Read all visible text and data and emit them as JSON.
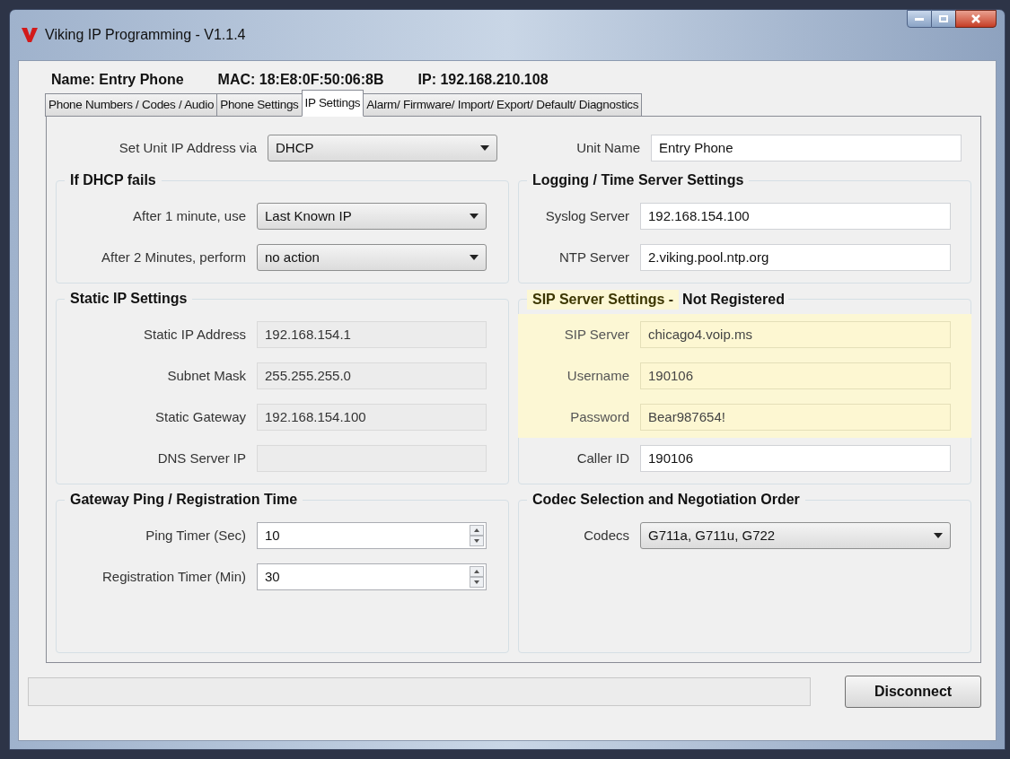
{
  "window": {
    "title": "Viking IP Programming - V1.1.4"
  },
  "header": [
    "Name: Entry Phone",
    "MAC: 18:E8:0F:50:06:8B",
    "IP: 192.168.210.108"
  ],
  "tabs": [
    {
      "label": "Phone Numbers / Codes / Audio",
      "selected": false
    },
    {
      "label": "Phone Settings",
      "selected": false
    },
    {
      "label": "IP Settings",
      "selected": true
    },
    {
      "label": "Alarm/ Firmware/ Import/ Export/ Default/ Diagnostics",
      "selected": false
    }
  ],
  "left": {
    "top": {
      "label": "Set Unit IP Address via",
      "value": "DHCP",
      "kind": "dropdown",
      "disabled": false,
      "highlighted": false
    },
    "groups": [
      {
        "title": "If DHCP fails",
        "highlighted": false,
        "fields": [
          {
            "label": "After 1 minute, use",
            "value": "Last Known IP",
            "kind": "dropdown",
            "disabled": false,
            "highlighted": false
          },
          {
            "label": "After 2 Minutes, perform",
            "value": "no action",
            "kind": "dropdown",
            "disabled": false,
            "highlighted": false
          }
        ]
      },
      {
        "title": "Static IP Settings",
        "highlighted": false,
        "fields": [
          {
            "label": "Static IP Address",
            "value": "192.168.154.1",
            "kind": "text",
            "disabled": true,
            "highlighted": false
          },
          {
            "label": "Subnet Mask",
            "value": "255.255.255.0",
            "kind": "text",
            "disabled": true,
            "highlighted": false
          },
          {
            "label": "Static Gateway",
            "value": "192.168.154.100",
            "kind": "text",
            "disabled": true,
            "highlighted": false
          },
          {
            "label": "DNS Server IP",
            "kind": "text",
            "disabled": true,
            "highlighted": false
          }
        ]
      },
      {
        "title": "Gateway Ping / Registration Time",
        "highlighted": false,
        "fields": [
          {
            "label": "Ping Timer (Sec)",
            "value": "10",
            "kind": "spinner",
            "disabled": false,
            "highlighted": false
          },
          {
            "label": "Registration Timer (Min)",
            "value": "30",
            "kind": "spinner",
            "disabled": false,
            "highlighted": false
          }
        ]
      }
    ]
  },
  "right": {
    "top": {
      "label": "Unit Name",
      "value": "Entry Phone",
      "kind": "text",
      "disabled": false,
      "highlighted": false
    },
    "groups": [
      {
        "title": "Logging / Time Server Settings",
        "highlighted": false,
        "fields": [
          {
            "label": "Syslog Server",
            "value": "192.168.154.100",
            "kind": "text",
            "disabled": false,
            "highlighted": false
          },
          {
            "label": "NTP Server",
            "value": "2.viking.pool.ntp.org",
            "kind": "text",
            "disabled": false,
            "highlighted": false
          }
        ]
      },
      {
        "title": "SIP Server Settings -",
        "status": "Not Registered",
        "highlighted": true,
        "fields": [
          {
            "label": "SIP Server",
            "value": "chicago4.voip.ms",
            "kind": "text",
            "disabled": false,
            "highlighted": true
          },
          {
            "label": "Username",
            "value": "190106",
            "kind": "text",
            "disabled": false,
            "highlighted": true
          },
          {
            "label": "Password",
            "value": "Bear987654!",
            "kind": "text",
            "disabled": false,
            "highlighted": true
          },
          {
            "label": "Caller ID",
            "value": "190106",
            "kind": "text",
            "disabled": false,
            "highlighted": false
          }
        ]
      },
      {
        "title": "Codec Selection and Negotiation Order",
        "highlighted": false,
        "fields": [
          {
            "label": "Codecs",
            "value": "G711a, G711u, G722",
            "kind": "dropdown",
            "disabled": false,
            "highlighted": false
          }
        ]
      }
    ]
  },
  "disconnect_button": "Disconnect"
}
